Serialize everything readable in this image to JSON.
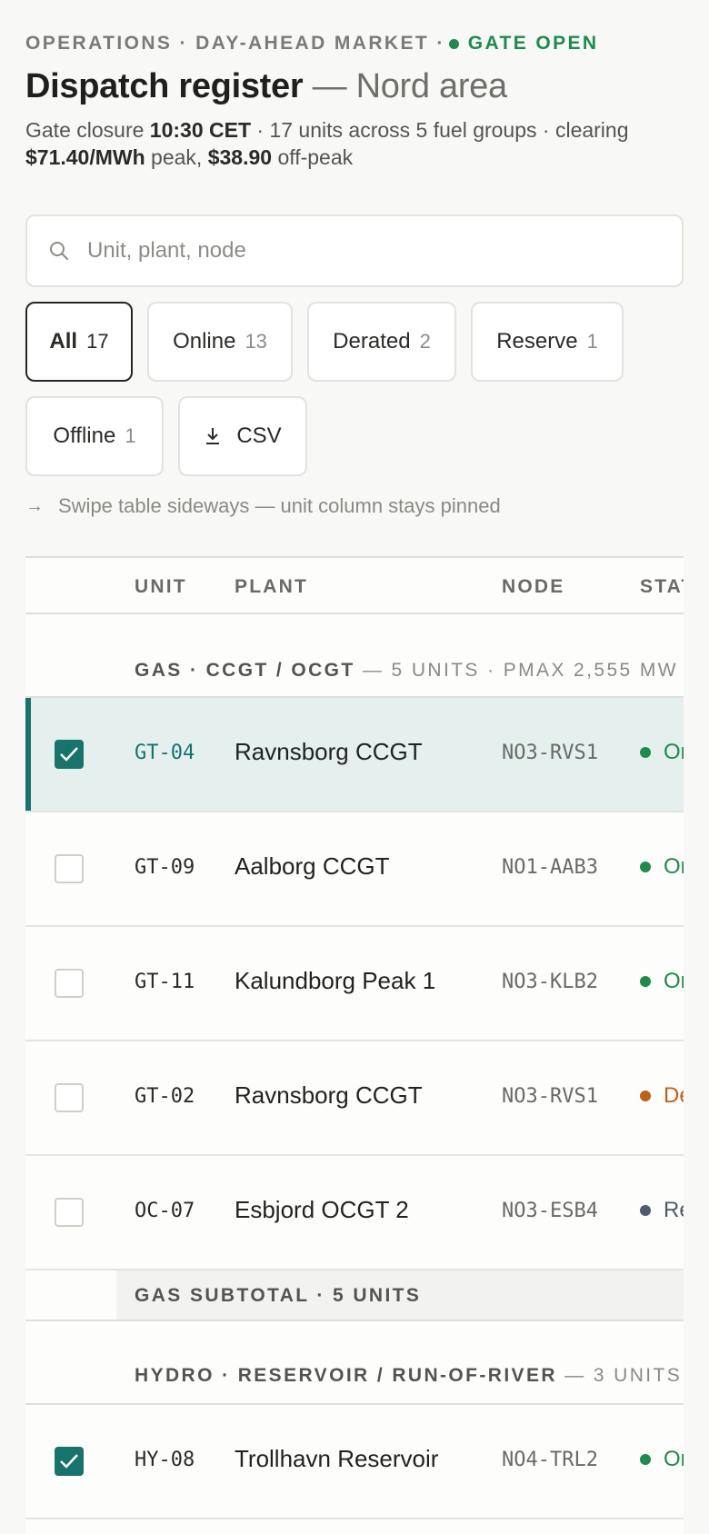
{
  "header": {
    "eyebrow_prefix": "OPERATIONS · DAY-AHEAD MARKET ·",
    "gate_status": "GATE OPEN",
    "title": "Dispatch register",
    "subtitle": "— Nord area",
    "summary": {
      "p1": "Gate closure ",
      "gate_time": "10:30 CET",
      "p2": " · 17 units across 5 fuel groups · clearing ",
      "peak_price": "$71.40/MWh",
      "p3": " peak, ",
      "offpeak_price": "$38.90",
      "p4": " off-peak"
    }
  },
  "search": {
    "placeholder": "Unit, plant, node"
  },
  "filters": [
    {
      "label": "All",
      "count": "17"
    },
    {
      "label": "Online",
      "count": "13"
    },
    {
      "label": "Derated",
      "count": "2"
    },
    {
      "label": "Reserve",
      "count": "1"
    },
    {
      "label": "Offline",
      "count": "1"
    }
  ],
  "csv_label": "CSV",
  "hint": "Swipe table sideways — unit column stays pinned",
  "table": {
    "columns": {
      "unit": "UNIT",
      "plant": "PLANT",
      "node": "NODE",
      "status": "STATUS"
    },
    "groups": [
      {
        "name": "GAS · CCGT / OCGT",
        "meta": "— 5 UNITS · PMAX 2,555 MW ·",
        "rows": [
          {
            "unit": "GT-04",
            "plant": "Ravnsborg CCGT",
            "node": "NO3-RVS1",
            "status": "Online"
          },
          {
            "unit": "GT-09",
            "plant": "Aalborg CCGT",
            "node": "NO1-AAB3",
            "status": "Online"
          },
          {
            "unit": "GT-11",
            "plant": "Kalundborg Peak 1",
            "node": "NO3-KLB2",
            "status": "Online"
          },
          {
            "unit": "GT-02",
            "plant": "Ravnsborg CCGT",
            "node": "NO3-RVS1",
            "status": "Derated"
          },
          {
            "unit": "OC-07",
            "plant": "Esbjord OCGT 2",
            "node": "NO3-ESB4",
            "status": "Reserve"
          }
        ],
        "subtotal": "GAS SUBTOTAL · 5 UNITS"
      },
      {
        "name": "HYDRO · RESERVOIR / RUN-OF-RIVER",
        "meta": "— 3 UNITS ·",
        "rows": [
          {
            "unit": "HY-08",
            "plant": "Trollhavn Reservoir",
            "node": "NO4-TRL2",
            "status": "Online"
          }
        ]
      }
    ]
  },
  "colors": {
    "online": "#1f8a4c",
    "derated": "#c0601a",
    "reserve": "#4f5a6b",
    "selected_accent": "#17736c"
  }
}
